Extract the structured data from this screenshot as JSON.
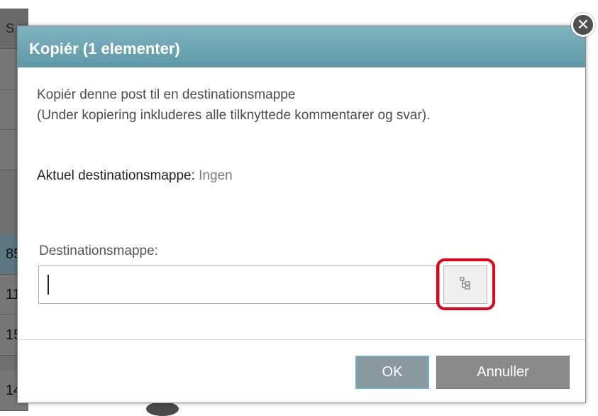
{
  "background": {
    "rows": [
      "S",
      "",
      "",
      "",
      "85",
      "11",
      "15",
      "14"
    ]
  },
  "dialog": {
    "title": "Kopiér (1 elementer)",
    "close_icon": "close-icon",
    "description_line1": "Kopiér denne post til en destinationsmappe",
    "description_line2": "(Under kopiering inkluderes alle tilknyttede kommentarer og svar).",
    "current_destination_label": "Aktuel destinationsmappe:",
    "current_destination_value": "Ingen",
    "destination_field_label": "Destinationsmappe:",
    "destination_value": "",
    "browse_icon": "folder-tree-icon",
    "ok_label": "OK",
    "cancel_label": "Annuller"
  },
  "colors": {
    "header": "#6fa7b5",
    "highlight": "#e3001b",
    "button": "#8a8a8a"
  }
}
